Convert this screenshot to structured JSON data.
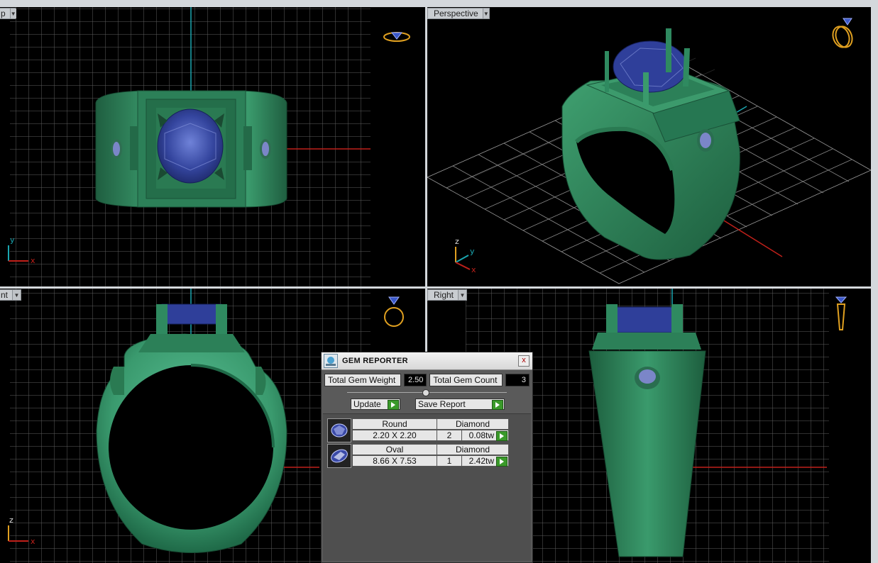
{
  "viewports": {
    "top": {
      "label": "p"
    },
    "perspective": {
      "label": "Perspective"
    },
    "front": {
      "label": "nt"
    },
    "right": {
      "label": "Right"
    }
  },
  "axes": {
    "x": "x",
    "y": "y",
    "z": "z"
  },
  "gem_reporter": {
    "title": "GEM REPORTER",
    "close_glyph": "x",
    "total_weight_label": "Total Gem Weight",
    "total_weight_value": "2.50",
    "total_count_label": "Total Gem Count",
    "total_count_value": "3",
    "update_label": "Update",
    "save_report_label": "Save Report",
    "gems": [
      {
        "shape": "Round",
        "type": "Diamond",
        "size": "2.20 X 2.20",
        "count": "2",
        "weight": "0.08tw"
      },
      {
        "shape": "Oval",
        "type": "Diamond",
        "size": "8.66 X 7.53",
        "count": "1",
        "weight": "2.42tw"
      }
    ]
  },
  "colors": {
    "viewport_bg": "#000000",
    "grid": "#6a6a6a",
    "axis_x": "#c0201a",
    "axis_y": "#1aa6b0",
    "metal": "#2f8a60",
    "gem": "#3a4aa8",
    "navcube": "#e0a020"
  }
}
